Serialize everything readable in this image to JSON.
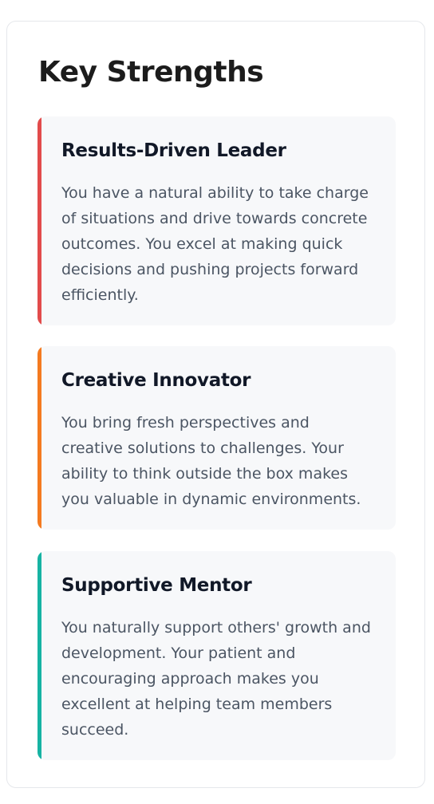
{
  "section": {
    "title": "Key Strengths"
  },
  "cards": [
    {
      "title": "Results-Driven Leader",
      "description": "You have a natural ability to take charge of situations and drive towards concrete outcomes. You excel at making quick decisions and pushing projects forward efficiently.",
      "accent_color": "#e24b4b"
    },
    {
      "title": "Creative Innovator",
      "description": "You bring fresh perspectives and creative solutions to challenges. Your ability to think outside the box makes you valuable in dynamic environments.",
      "accent_color": "#f47a20"
    },
    {
      "title": "Supportive Mentor",
      "description": "You naturally support others' growth and development. Your patient and encouraging approach makes you excellent at helping team members succeed.",
      "accent_color": "#16b3a3"
    }
  ]
}
